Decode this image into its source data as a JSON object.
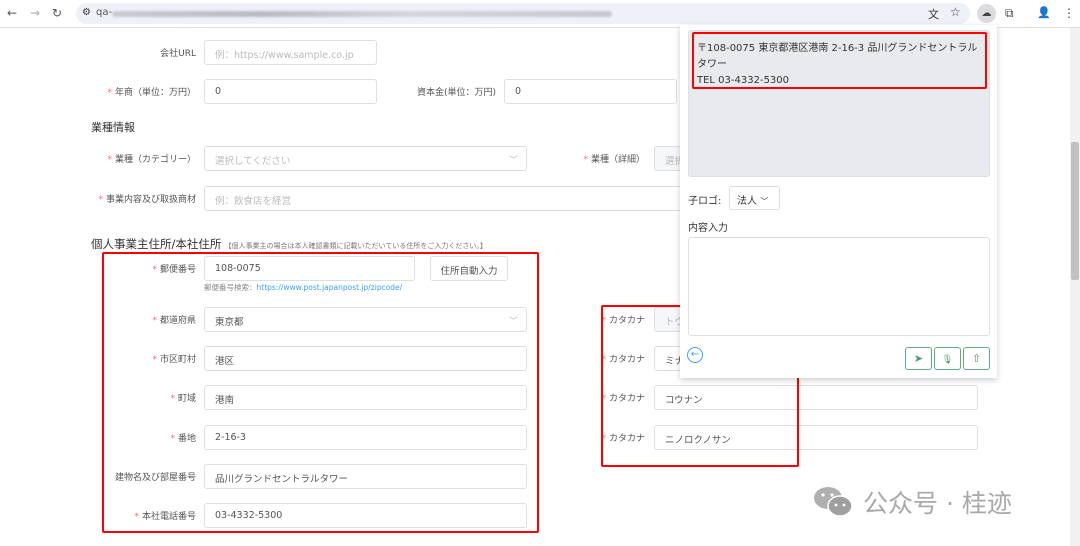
{
  "browser": {
    "url_prefix": "qa-",
    "back": "←",
    "forward": "→",
    "reload": "↻",
    "site_info": "⚙",
    "translate": "文",
    "star": "☆",
    "extension": "☁",
    "puzzle": "⧉",
    "avatar": "👤",
    "menu": "⋮"
  },
  "form": {
    "company_url": {
      "label": "会社URL",
      "placeholder": "例：https://www.sample.co.jp"
    },
    "annual_sales": {
      "label": "年商（単位：万円）",
      "value": "0"
    },
    "capital": {
      "label": "資本金(単位：万円)",
      "value": "0"
    },
    "industry_heading": "業種情報",
    "industry_category": {
      "label": "業種（カテゴリー）",
      "placeholder": "選択してください"
    },
    "industry_detail": {
      "label": "業種（詳細）",
      "placeholder": "選択"
    },
    "business_content": {
      "label": "事業内容及び取扱商材",
      "placeholder": "例：飲食店を経営"
    },
    "address_heading": "個人事業主住所/本社住所",
    "address_note": "【個人事業主の場合は本人確認書類に記載いただいている住所をご入力ください。】",
    "postal": {
      "label": "郵便番号",
      "value": "108-0075",
      "button": "住所自動入力",
      "help_prefix": "郵便番号検索：",
      "help_link": "https://www.post.japanpost.jp/zipcode/"
    },
    "prefecture": {
      "label": "都道府県",
      "value": "東京都"
    },
    "city": {
      "label": "市区町村",
      "value": "港区"
    },
    "town": {
      "label": "町域",
      "value": "港南"
    },
    "block": {
      "label": "番地",
      "value": "2-16-3"
    },
    "building": {
      "label": "建物名及び部屋番号",
      "value": "品川グランドセントラルタワー"
    },
    "phone": {
      "label": "本社電話番号",
      "value": "03-4332-5300"
    },
    "katakana_label": "カタカナ",
    "katakana": [
      "トウ",
      "ミナ",
      "コウナン",
      "ニノロクノサン"
    ],
    "required_mark": "*"
  },
  "popup": {
    "result_line1": "〒108-0075 東京都港区港南 2-16-3 品川グランドセントラル",
    "result_line2": "タワー",
    "result_line3": "TEL 03-4332-5300",
    "mode_label": "子ロゴ:",
    "mode_value": "法人",
    "content_label": "内容入力",
    "content_value": "",
    "icons": {
      "back": "←",
      "send": "➤",
      "mic": "🎙",
      "upload": "⇧"
    }
  },
  "watermark": {
    "text": "公众号 · 桂迹"
  },
  "colors": {
    "required": "#f56c6c",
    "highlight": "#ff0000",
    "link": "#409eff",
    "action": "#5fae82"
  }
}
